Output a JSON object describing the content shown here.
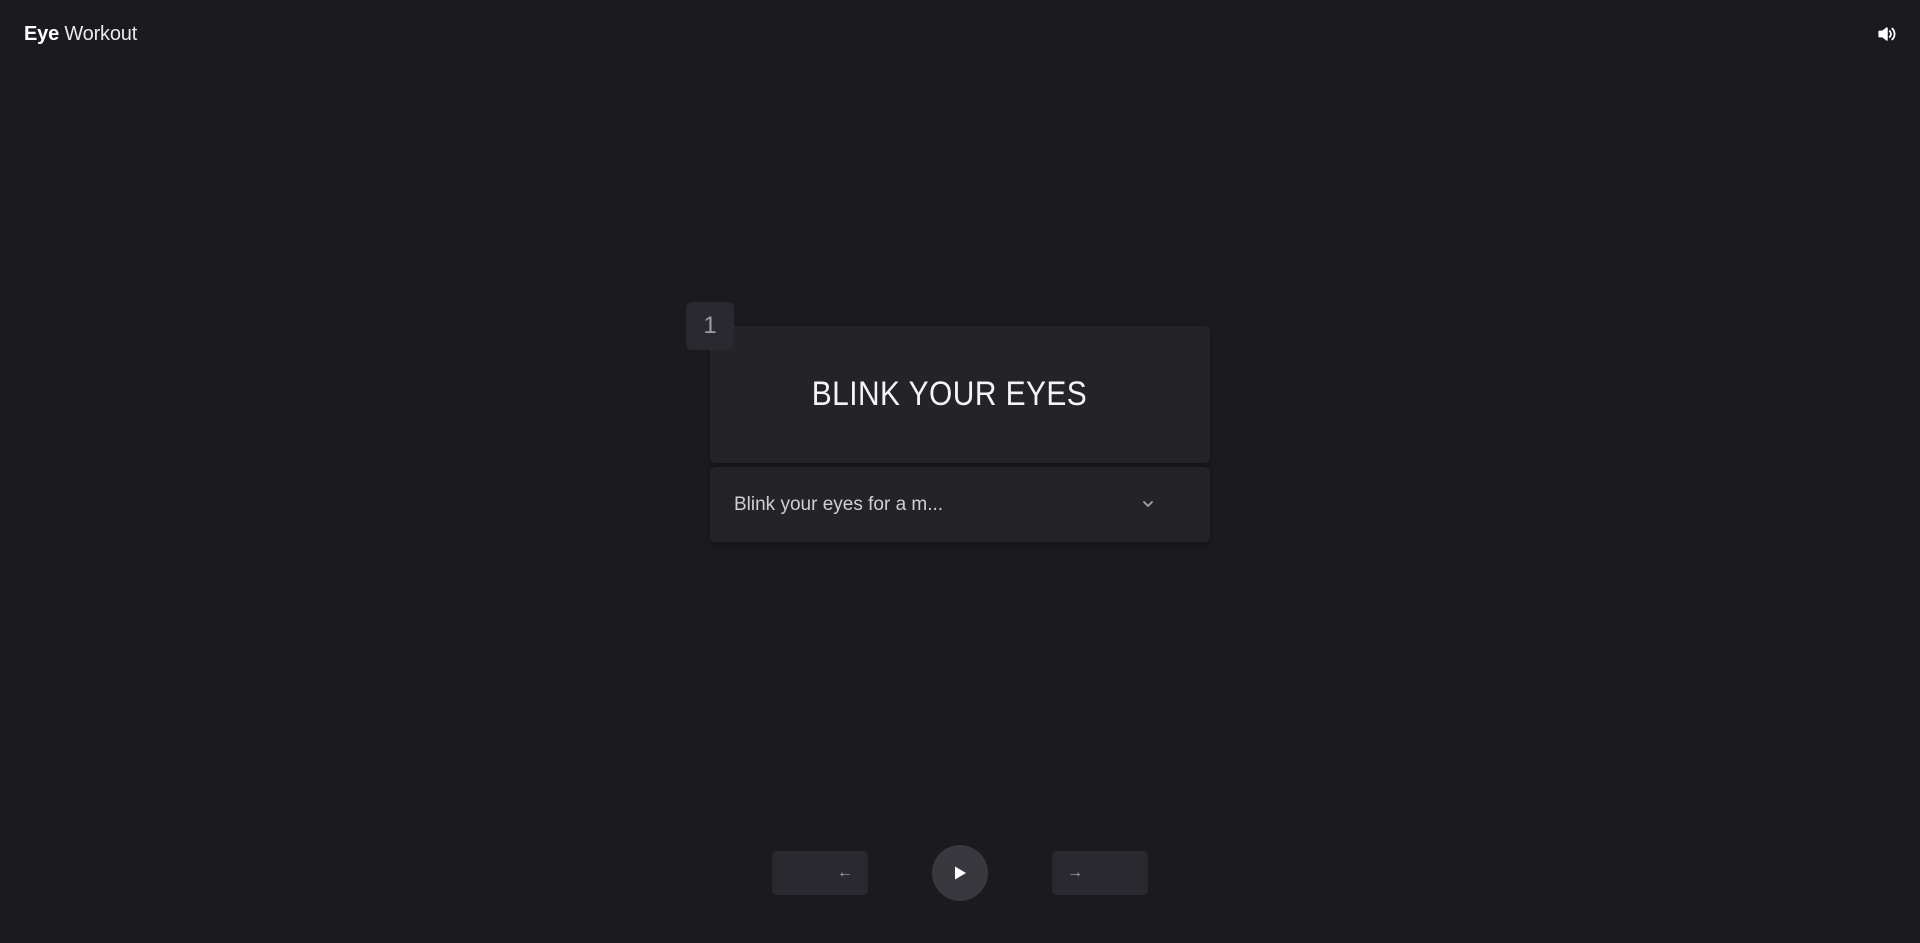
{
  "header": {
    "brand_bold": "Eye",
    "brand_light": " Workout",
    "sound_icon": "speaker-volume-icon"
  },
  "exercise": {
    "step_number": "1",
    "title": "BLINK YOUR EYES",
    "description": "Blink your eyes for a m...",
    "expand_icon": "chevron-down-icon"
  },
  "controls": {
    "prev_label": "←",
    "next_label": "→",
    "play_icon": "play-icon"
  },
  "colors": {
    "background": "#1b1a1f",
    "card": "#242328",
    "button": "#2a292f",
    "play_button": "#39383e",
    "text_primary": "#ffffff",
    "text_muted": "#cfcfd4"
  }
}
